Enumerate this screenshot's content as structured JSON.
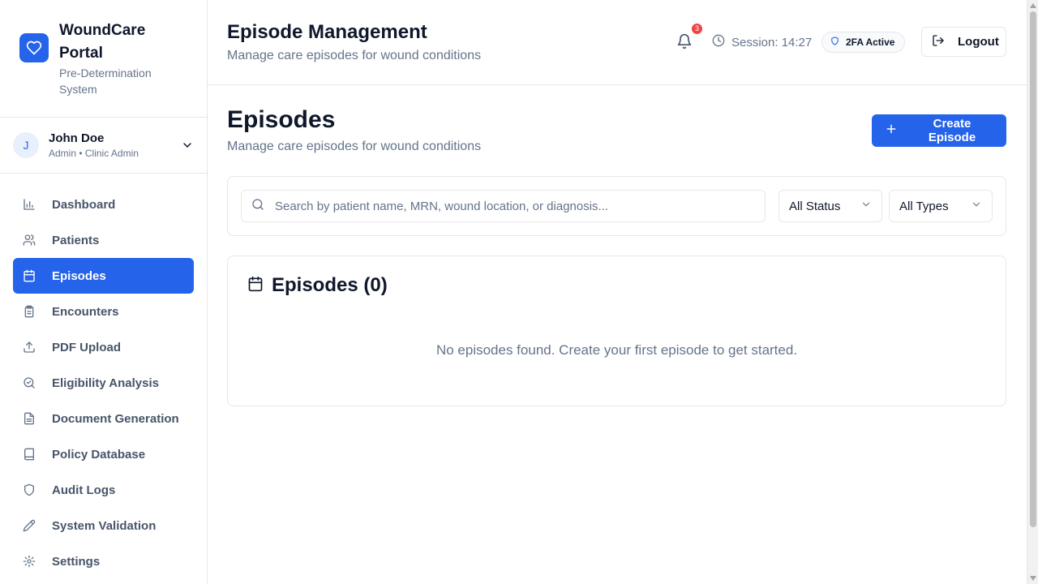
{
  "brand": {
    "title": "WoundCare Portal",
    "subtitle": "Pre-Determination System",
    "logo_icon": "heart-icon",
    "color": "#2563eb"
  },
  "user": {
    "initial": "J",
    "name": "John Doe",
    "role": "Admin • Clinic Admin"
  },
  "sidebar": {
    "items": [
      {
        "label": "Dashboard",
        "icon": "bar-chart-icon",
        "active": false
      },
      {
        "label": "Patients",
        "icon": "users-icon",
        "active": false
      },
      {
        "label": "Episodes",
        "icon": "calendar-icon",
        "active": true
      },
      {
        "label": "Encounters",
        "icon": "clipboard-icon",
        "active": false
      },
      {
        "label": "PDF Upload",
        "icon": "upload-icon",
        "active": false
      },
      {
        "label": "Eligibility Analysis",
        "icon": "search-check-icon",
        "active": false
      },
      {
        "label": "Document Generation",
        "icon": "file-text-icon",
        "active": false
      },
      {
        "label": "Policy Database",
        "icon": "book-icon",
        "active": false
      },
      {
        "label": "Audit Logs",
        "icon": "shield-icon",
        "active": false
      },
      {
        "label": "System Validation",
        "icon": "wrench-icon",
        "active": false
      },
      {
        "label": "Settings",
        "icon": "gear-icon",
        "active": false
      }
    ]
  },
  "header": {
    "title": "Episode Management",
    "subtitle": "Manage care episodes for wound conditions",
    "notification_count": "3",
    "session": "Session: 14:27",
    "twofa": "2FA Active",
    "logout": "Logout"
  },
  "page": {
    "title": "Episodes",
    "subtitle": "Manage care episodes for wound conditions",
    "create_label": "Create Episode"
  },
  "filters": {
    "search_placeholder": "Search by patient name, MRN, wound location, or diagnosis...",
    "search_value": "",
    "status": "All Status",
    "types": "All Types"
  },
  "episodes": {
    "title": "Episodes (0)",
    "empty": "No episodes found. Create your first episode to get started."
  },
  "colors": {
    "accent": "#2563eb",
    "badge": "#ef4444",
    "muted_text": "#64748b"
  }
}
